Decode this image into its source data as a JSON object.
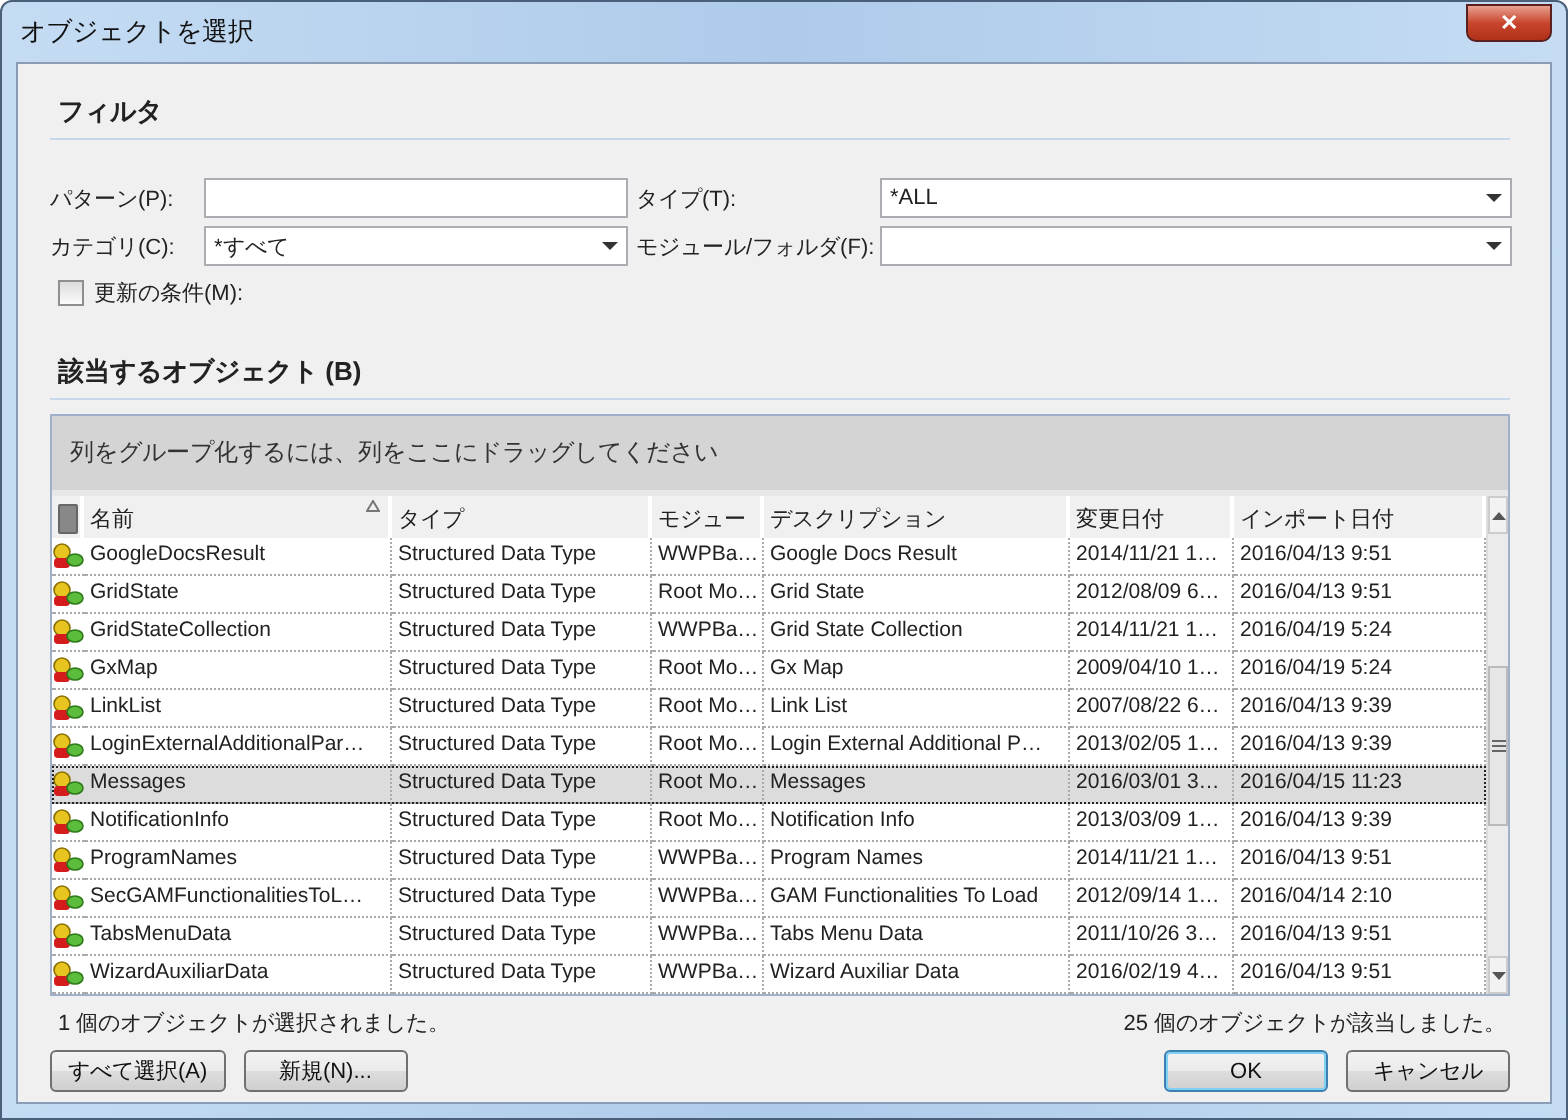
{
  "window": {
    "title": "オブジェクトを選択",
    "close": "✕"
  },
  "filter": {
    "heading": "フィルタ",
    "fields": [
      {
        "label": "パターン(P):",
        "kind": "text"
      },
      {
        "label": "タイプ(T):",
        "kind": "combo",
        "value": "*ALL"
      },
      {
        "label": "カテゴリ(C):",
        "kind": "combo",
        "value": "*すべて"
      },
      {
        "label": "モジュール/フォルダ(F):",
        "kind": "combo"
      }
    ],
    "condition": {
      "label": "更新の条件(M):",
      "checked": false
    }
  },
  "results": {
    "heading": "該当するオブジェクト (B)",
    "group_hint": "列をグループ化するには、列をここにドラッグしてください",
    "columns": [
      "名前",
      "タイプ",
      "モジュー",
      "デスクリプション",
      "変更日付",
      "インポート日付"
    ],
    "rows": [
      {
        "name": "GoogleDocsResult",
        "type": "Structured Data Type",
        "module": "WWPBa…",
        "description": "Google Docs Result",
        "modified": "2014/11/21  1…",
        "imported": "2016/04/13 9:51",
        "selected": false
      },
      {
        "name": "GridState",
        "type": "Structured Data Type",
        "module": "Root  Mo…",
        "description": "Grid State",
        "modified": "2012/08/09  6…",
        "imported": "2016/04/13 9:51",
        "selected": false
      },
      {
        "name": "GridStateCollection",
        "type": "Structured Data Type",
        "module": "WWPBa…",
        "description": "Grid State Collection",
        "modified": "2014/11/21  1…",
        "imported": "2016/04/19 5:24",
        "selected": false
      },
      {
        "name": "GxMap",
        "type": "Structured Data Type",
        "module": "Root  Mo…",
        "description": "Gx Map",
        "modified": "2009/04/10  1…",
        "imported": "2016/04/19 5:24",
        "selected": false
      },
      {
        "name": "LinkList",
        "type": "Structured Data Type",
        "module": "Root  Mo…",
        "description": "Link List",
        "modified": "2007/08/22  6…",
        "imported": "2016/04/13 9:39",
        "selected": false
      },
      {
        "name": "LoginExternalAdditionalPar…",
        "type": "Structured Data Type",
        "module": "Root  Mo…",
        "description": "Login External Additional P…",
        "modified": "2013/02/05  1…",
        "imported": "2016/04/13 9:39",
        "selected": false
      },
      {
        "name": "Messages",
        "type": "Structured Data Type",
        "module": "Root  Mo…",
        "description": "Messages",
        "modified": "2016/03/01  3…",
        "imported": "2016/04/15 11:23",
        "selected": true
      },
      {
        "name": "NotificationInfo",
        "type": "Structured Data Type",
        "module": "Root  Mo…",
        "description": "Notification Info",
        "modified": "2013/03/09  1…",
        "imported": "2016/04/13 9:39",
        "selected": false
      },
      {
        "name": "ProgramNames",
        "type": "Structured Data Type",
        "module": "WWPBa…",
        "description": "Program Names",
        "modified": "2014/11/21  1…",
        "imported": "2016/04/13 9:51",
        "selected": false
      },
      {
        "name": "SecGAMFunctionalitiesToL…",
        "type": "Structured Data Type",
        "module": "WWPBa…",
        "description": "GAM Functionalities To Load",
        "modified": "2012/09/14  1…",
        "imported": "2016/04/14 2:10",
        "selected": false
      },
      {
        "name": "TabsMenuData",
        "type": "Structured Data Type",
        "module": "WWPBa…",
        "description": "Tabs Menu Data",
        "modified": "2011/10/26  3…",
        "imported": "2016/04/13 9:51",
        "selected": false
      },
      {
        "name": "WizardAuxiliarData",
        "type": "Structured Data Type",
        "module": "WWPBa…",
        "description": "Wizard Auxiliar Data",
        "modified": "2016/02/19  4…",
        "imported": "2016/04/13 9:51",
        "selected": false
      }
    ],
    "selected_status": "1 個のオブジェクトが選択されました。",
    "match_status": "25 個のオブジェクトが該当しました。"
  },
  "buttons": [
    {
      "label": "すべて選択(A)",
      "kind": "left"
    },
    {
      "label": "新規(N)...",
      "kind": "left"
    },
    {
      "label": "OK",
      "kind": "default"
    },
    {
      "label": "キャンセル",
      "kind": "right"
    }
  ]
}
